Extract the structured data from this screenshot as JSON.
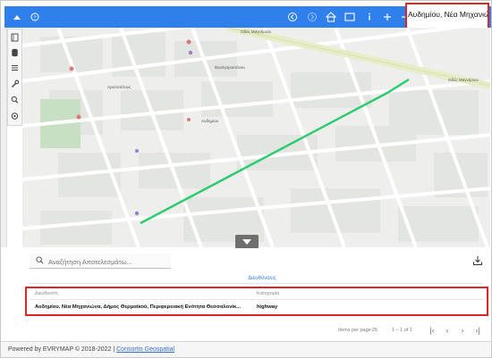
{
  "toolbar": {
    "left_icons": [
      "expand-up-icon",
      "help-icon"
    ],
    "right_icons": [
      "back-icon",
      "forward-icon",
      "home-icon",
      "fullscreen-icon",
      "info-icon",
      "zoom-in-icon",
      "zoom-out-icon"
    ],
    "location_text": "Αυδημίου, Νέα Μηχανιώνα"
  },
  "sidebar_tools": [
    "layers-icon",
    "database-icon",
    "list-icon",
    "wrench-icon",
    "search-icon",
    "settings-icon"
  ],
  "map": {
    "labels": {
      "street_top_right_a": "Οδός Μαγνήσιου",
      "street_top_right_b": "Οδός Μαγνήσιου",
      "street_mid": "Βουλγαροκτόνου",
      "street_mid2": "Αριστοτέλους",
      "street_center": "Αυδημίου"
    },
    "highlight_color": "#2ecc71"
  },
  "results": {
    "search_placeholder": "Αναζήτηση Αποτελεσμάτω...",
    "tab_label": "Διευθύνσεις",
    "columns": [
      "Διεύθυνση",
      "Κατηγορία"
    ],
    "rows": [
      {
        "address": "Αυδημίου, Νέα Μηχανιώνα, Δήμος Θερμαϊκού, Περιφερειακή Ενότητα Θεσσαλονίκ...",
        "category": "highway"
      }
    ],
    "pagination": {
      "items_per_page_label": "Items per page:",
      "items_per_page_value": "25",
      "range_text": "1 – 1 of 1"
    }
  },
  "footer": {
    "text": "Powered by EVRYMAP © 2018-2022 | ",
    "link": "Consortis Geospatial"
  }
}
